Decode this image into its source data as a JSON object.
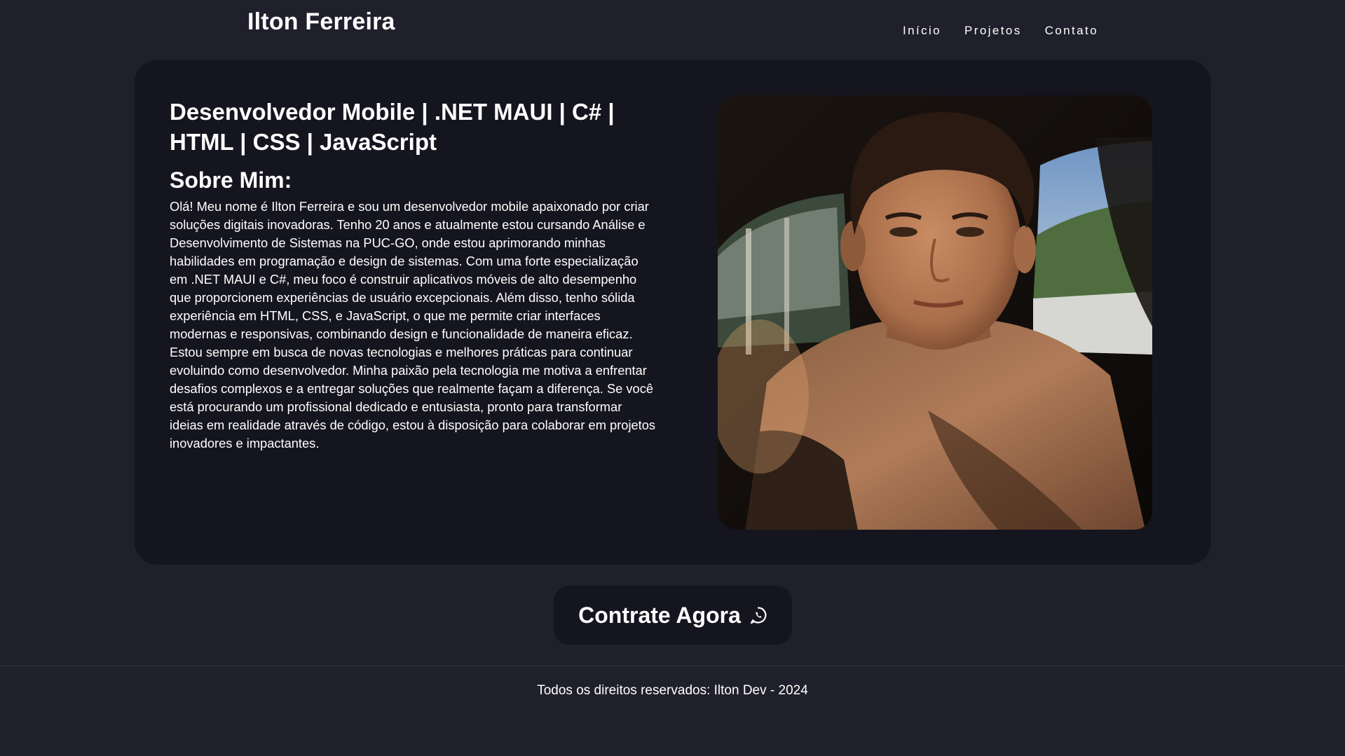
{
  "header": {
    "site_title": "Ilton Ferreira",
    "nav": [
      {
        "label": "Início"
      },
      {
        "label": "Projetos"
      },
      {
        "label": "Contato"
      }
    ]
  },
  "main": {
    "headline": "Desenvolvedor Mobile | .NET MAUI | C# | HTML | CSS | JavaScript",
    "about_title": "Sobre Mim:",
    "about_text": "Olá! Meu nome é Ilton Ferreira e sou um desenvolvedor mobile apaixonado por criar soluções digitais inovadoras. Tenho 20 anos e atualmente estou cursando Análise e Desenvolvimento de Sistemas na PUC-GO, onde estou aprimorando minhas habilidades em programação e design de sistemas. Com uma forte especialização em .NET MAUI e C#, meu foco é construir aplicativos móveis de alto desempenho que proporcionem experiências de usuário excepcionais. Além disso, tenho sólida experiência em HTML, CSS, e JavaScript, o que me permite criar interfaces modernas e responsivas, combinando design e funcionalidade de maneira eficaz. Estou sempre em busca de novas tecnologias e melhores práticas para continuar evoluindo como desenvolvedor. Minha paixão pela tecnologia me motiva a enfrentar desafios complexos e a entregar soluções que realmente façam a diferença. Se você está procurando um profissional dedicado e entusiasta, pronto para transformar ideias em realidade através de código, estou à disposição para colaborar em projetos inovadores e impactantes.",
    "photo_icon": "profile-photo"
  },
  "cta": {
    "label": "Contrate Agora",
    "icon": "whatsapp-icon"
  },
  "footer": {
    "text": "Todos os direitos reservados: Ilton Dev - 2024"
  },
  "colors": {
    "background": "#20202c",
    "card": "#15151f",
    "text": "#ffffff"
  }
}
